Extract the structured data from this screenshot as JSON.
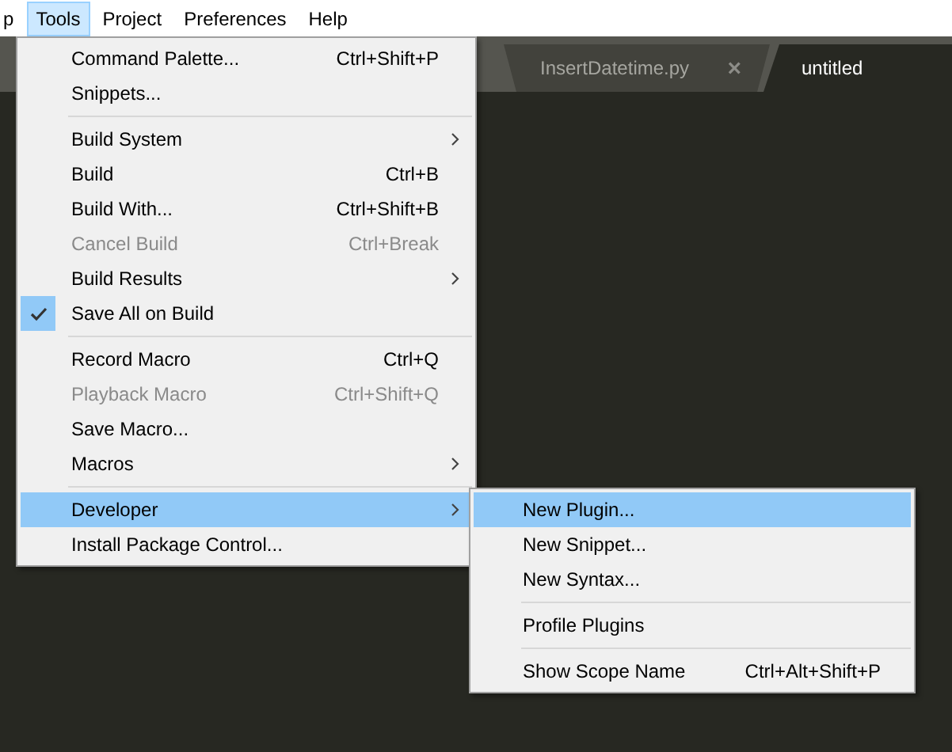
{
  "menubar": [
    {
      "label": "p",
      "selected": false
    },
    {
      "label": "Tools",
      "selected": true
    },
    {
      "label": "Project",
      "selected": false
    },
    {
      "label": "Preferences",
      "selected": false
    },
    {
      "label": "Help",
      "selected": false
    }
  ],
  "tabs": [
    {
      "label": "InsertDatetime.py",
      "selected": false,
      "close": "×"
    },
    {
      "label": "untitled",
      "selected": true
    }
  ],
  "tools_menu": [
    {
      "kind": "item",
      "label": "Command Palette...",
      "shortcut": "Ctrl+Shift+P",
      "submenu": false,
      "disabled": false,
      "checked": false,
      "selected": false
    },
    {
      "kind": "item",
      "label": "Snippets...",
      "submenu": false,
      "disabled": false,
      "checked": false,
      "selected": false
    },
    {
      "kind": "separator"
    },
    {
      "kind": "item",
      "label": "Build System",
      "submenu": true,
      "disabled": false,
      "checked": false,
      "selected": false
    },
    {
      "kind": "item",
      "label": "Build",
      "shortcut": "Ctrl+B",
      "submenu": false,
      "disabled": false,
      "checked": false,
      "selected": false
    },
    {
      "kind": "item",
      "label": "Build With...",
      "shortcut": "Ctrl+Shift+B",
      "submenu": false,
      "disabled": false,
      "checked": false,
      "selected": false
    },
    {
      "kind": "item",
      "label": "Cancel Build",
      "shortcut": "Ctrl+Break",
      "submenu": false,
      "disabled": true,
      "checked": false,
      "selected": false
    },
    {
      "kind": "item",
      "label": "Build Results",
      "submenu": true,
      "disabled": false,
      "checked": false,
      "selected": false
    },
    {
      "kind": "item",
      "label": "Save All on Build",
      "submenu": false,
      "disabled": false,
      "checked": true,
      "selected": false
    },
    {
      "kind": "separator"
    },
    {
      "kind": "item",
      "label": "Record Macro",
      "shortcut": "Ctrl+Q",
      "submenu": false,
      "disabled": false,
      "checked": false,
      "selected": false
    },
    {
      "kind": "item",
      "label": "Playback Macro",
      "shortcut": "Ctrl+Shift+Q",
      "submenu": false,
      "disabled": true,
      "checked": false,
      "selected": false
    },
    {
      "kind": "item",
      "label": "Save Macro...",
      "submenu": false,
      "disabled": false,
      "checked": false,
      "selected": false
    },
    {
      "kind": "item",
      "label": "Macros",
      "submenu": true,
      "disabled": false,
      "checked": false,
      "selected": false
    },
    {
      "kind": "separator"
    },
    {
      "kind": "item",
      "label": "Developer",
      "submenu": true,
      "disabled": false,
      "checked": false,
      "selected": true
    },
    {
      "kind": "item",
      "label": "Install Package Control...",
      "submenu": false,
      "disabled": false,
      "checked": false,
      "selected": false
    }
  ],
  "developer_submenu": [
    {
      "kind": "item",
      "label": "New Plugin...",
      "submenu": false,
      "disabled": false,
      "checked": false,
      "selected": true
    },
    {
      "kind": "item",
      "label": "New Snippet...",
      "submenu": false,
      "disabled": false,
      "checked": false,
      "selected": false
    },
    {
      "kind": "item",
      "label": "New Syntax...",
      "submenu": false,
      "disabled": false,
      "checked": false,
      "selected": false
    },
    {
      "kind": "separator"
    },
    {
      "kind": "item",
      "label": "Profile Plugins",
      "submenu": false,
      "disabled": false,
      "checked": false,
      "selected": false
    },
    {
      "kind": "separator"
    },
    {
      "kind": "item",
      "label": "Show Scope Name",
      "shortcut": "Ctrl+Alt+Shift+P",
      "submenu": false,
      "disabled": false,
      "checked": false,
      "selected": false
    }
  ]
}
